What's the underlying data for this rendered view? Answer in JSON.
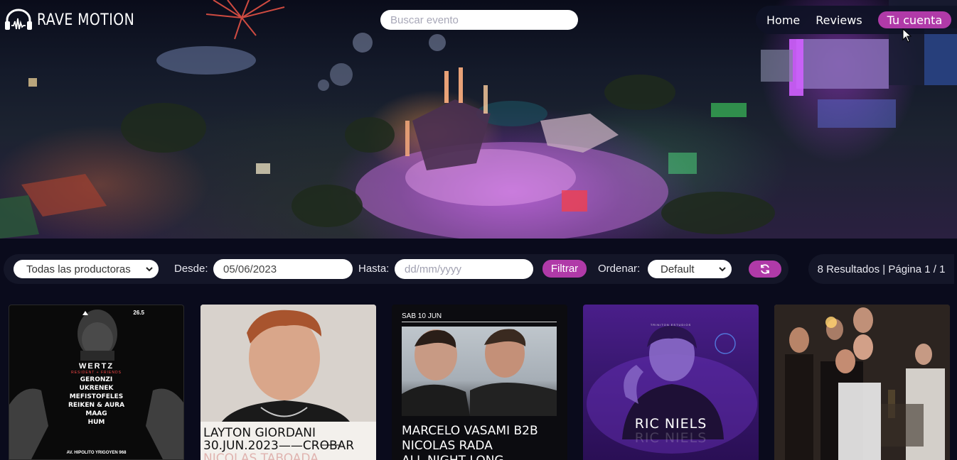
{
  "brand": {
    "name": "RAVE MOTION",
    "icon": "headphones-waveform-icon"
  },
  "search": {
    "placeholder": "Buscar evento"
  },
  "nav": {
    "home": "Home",
    "reviews": "Reviews",
    "account": "Tu cuenta"
  },
  "filters": {
    "producer": "Todas las productoras",
    "from_label": "Desde:",
    "from_value": "05/06/2023",
    "to_label": "Hasta:",
    "to_placeholder": "dd/mm/yyyy",
    "filter_button": "Filtrar",
    "order_label": "Ordenar:",
    "order_value": "Default",
    "refresh_icon": "refresh-icon"
  },
  "results": {
    "text": "8 Resultados | Página 1 / 1"
  },
  "colors": {
    "accent": "#b03aa8",
    "background": "#0a0b1c",
    "panel": "#141628"
  },
  "cards": [
    {
      "date": "26.5",
      "title": "WERTZ",
      "subtitle": "RESIDENT + FRIENDS",
      "lineup": [
        "GERONZI",
        "UKRENEK",
        "MEFISTOFELES",
        "REIKEN & AURA",
        "MAAG",
        "HUM"
      ],
      "address": "AV. HIPOLITO YRIGOYEN 968"
    },
    {
      "line1": "LAYTON GIORDANI",
      "line2": "30.JUN.2023",
      "line2b": "CROBAR",
      "line3": "NICOLAS TABOADA"
    },
    {
      "top": "SAB 10 JUN",
      "line1": "MARCELO VASAMI B2B",
      "line2": "NICOLAS RADA",
      "line3": "ALL NIGHT LONG"
    },
    {
      "small": "TRINITON ESTUDIOS",
      "name": "RIC NIELS",
      "ghost": "RIC NIELS"
    },
    {}
  ]
}
